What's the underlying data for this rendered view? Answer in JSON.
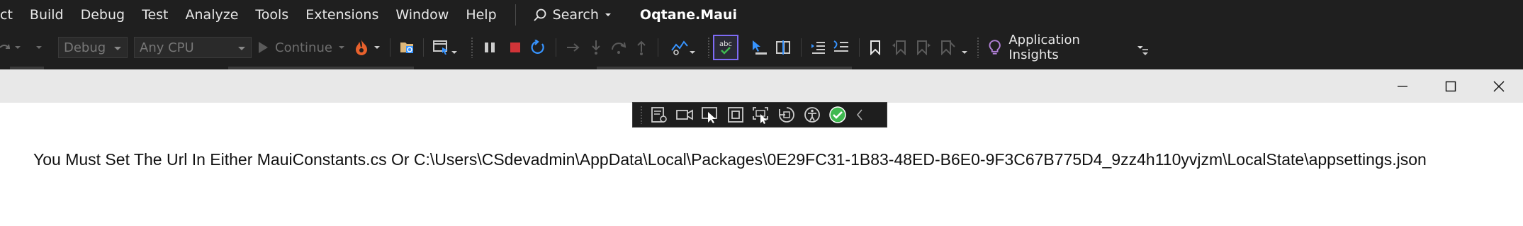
{
  "menubar": {
    "items": [
      "ct",
      "Build",
      "Debug",
      "Test",
      "Analyze",
      "Tools",
      "Extensions",
      "Window",
      "Help"
    ],
    "search_label": "Search",
    "solution_name": "Oqtane.Maui"
  },
  "toolbar": {
    "configuration": "Debug",
    "platform": "Any CPU",
    "continue_label": "Continue",
    "app_insights_label": "Application Insights"
  },
  "app": {
    "message": "You Must Set The Url In Either MauiConstants.cs Or C:\\Users\\CSdevadmin\\AppData\\Local\\Packages\\0E29FC31-1B83-48ED-B6E0-9F3C67B775D4_9zz4h110yvjzm\\LocalState\\appsettings.json"
  },
  "colors": {
    "ide_background": "#1f1f1f",
    "stop_red": "#d13438",
    "accent_blue": "#3794ff",
    "hot_reload_orange": "#e8612c",
    "success_green": "#3fb950"
  }
}
